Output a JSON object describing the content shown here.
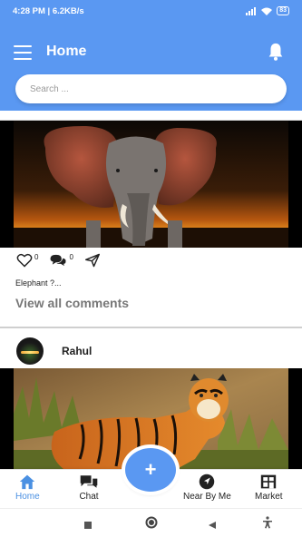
{
  "status_bar": {
    "time_speed": "4:28 PM | 6.2KB/s",
    "battery": "83"
  },
  "header": {
    "title": "Home",
    "icons": {
      "menu": "hamburger-menu-icon",
      "notifications": "bell-icon"
    }
  },
  "search": {
    "placeholder": "Search ..."
  },
  "posts": [
    {
      "image": "elephant-photo",
      "likes": "0",
      "comments": "0",
      "caption": "Elephant ?...",
      "view_comments": "View all comments"
    },
    {
      "author": "Rahul",
      "image": "tiger-photo"
    }
  ],
  "bottom_nav": {
    "items": [
      {
        "label": "Home",
        "icon": "home-icon",
        "active": true
      },
      {
        "label": "Chat",
        "icon": "chat-icon",
        "active": false
      },
      {
        "label": "Near By Me",
        "icon": "navigation-arrow-icon",
        "active": false
      },
      {
        "label": "Market",
        "icon": "store-icon",
        "active": false
      }
    ],
    "fab_label": "+"
  },
  "colors": {
    "primary": "#5a98f2",
    "active_nav": "#4a90e2"
  }
}
